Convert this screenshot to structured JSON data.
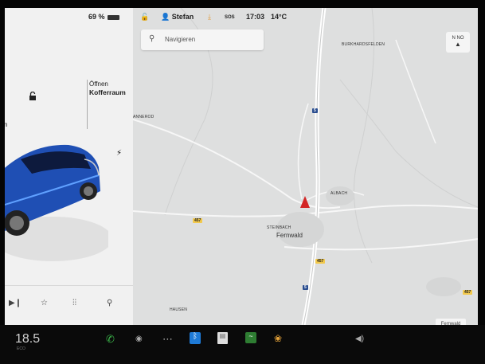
{
  "status": {
    "battery": "69 %",
    "user": "Stefan",
    "sos": "SOS",
    "time": "17:03",
    "temp": "14°C"
  },
  "car_panel": {
    "side_label": "n",
    "trunk_line1": "Öffnen",
    "trunk_line2": "Kofferraum"
  },
  "search": {
    "placeholder": "Navigieren"
  },
  "compass": {
    "letters": "N NO"
  },
  "map_labels": {
    "burkhardsfelden": "BURKHARDSFELDEN",
    "annerod": "ANNEROD",
    "albach": "ALBACH",
    "steinbach": "STEINBACH",
    "fernwald": "Fernwald",
    "hausen": "HAUSEN"
  },
  "road_shields": {
    "a5_top": "5",
    "a5_bottom": "5",
    "b457_left": "457",
    "b457_right": "457",
    "b457_edge": "457"
  },
  "place_button": "Fernwald",
  "dock": {
    "cabin_temp": "18.5",
    "temp_sub": "ECO"
  },
  "colors": {
    "nav_arrow": "#d32525",
    "phone": "#3bb54a",
    "bluetooth": "#1e7ad6"
  }
}
